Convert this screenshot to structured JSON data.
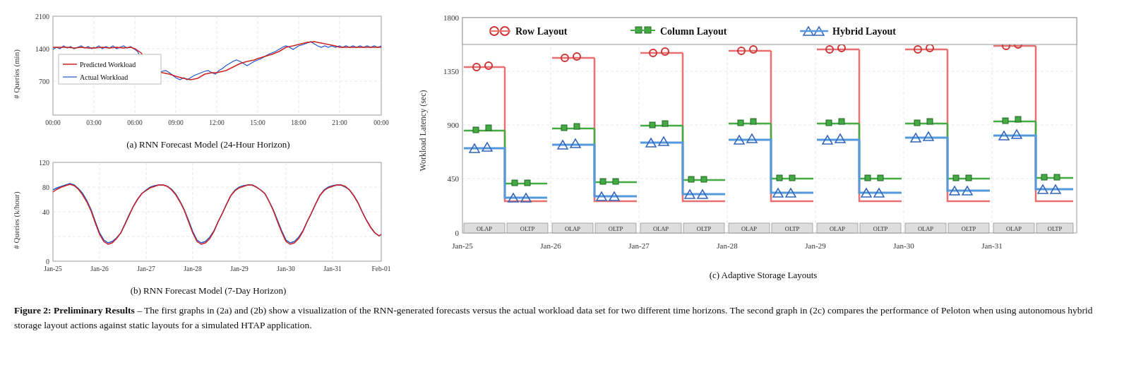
{
  "charts": {
    "chart_a": {
      "title": "(a) RNN Forecast Model (24-Hour Horizon)",
      "y_label": "# Queries (min)",
      "y_ticks": [
        "2100",
        "1400",
        "700"
      ],
      "x_ticks": [
        "00:00",
        "03:00",
        "06:00",
        "09:00",
        "12:00",
        "15:00",
        "18:00",
        "21:00",
        "00:00"
      ],
      "legend": {
        "predicted": "Predicted Workload",
        "actual": "Actual Workload"
      }
    },
    "chart_b": {
      "title": "(b) RNN Forecast Model (7-Day Horizon)",
      "y_label": "# Queries (k/hour)",
      "y_ticks": [
        "120",
        "80",
        "40",
        "0"
      ],
      "x_ticks": [
        "Jan-25",
        "Jan-26",
        "Jan-27",
        "Jan-28",
        "Jan-29",
        "Jan-30",
        "Jan-31",
        "Feb-01"
      ]
    },
    "chart_c": {
      "title": "(c) Adaptive Storage Layouts",
      "y_label": "Workload Latency (sec)",
      "y_ticks": [
        "1800",
        "1350",
        "900",
        "450",
        "0"
      ],
      "x_ticks": [
        "Jan-25",
        "Jan-26",
        "Jan-27",
        "Jan-28",
        "Jan-29",
        "Jan-30",
        "Jan-31"
      ],
      "legend": {
        "row": "Row Layout",
        "column": "Column Layout",
        "hybrid": "Hybrid Layout"
      }
    }
  },
  "figure_caption": "Figure 2: Preliminary Results – The first graphs in (2a) and (2b) show a visualization of the RNN-generated forecasts versus the actual workload data set for two different time horizons. The second graph in (2c) compares the performance of Peloton when using autonomous hybrid storage layout actions against static layouts for a simulated HTAP application."
}
